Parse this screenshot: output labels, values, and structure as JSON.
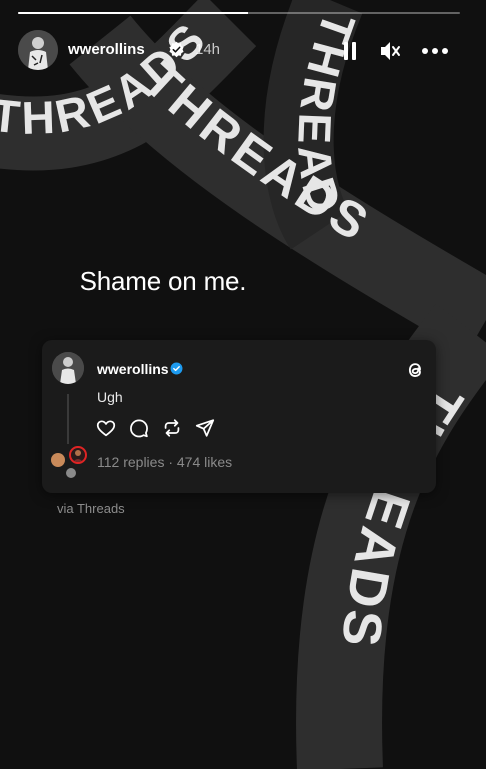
{
  "story": {
    "progress": 0.52,
    "username": "wwerollins",
    "time": "14h",
    "caption": "Shame on me.",
    "via_label": "via Threads",
    "background_ribbon_text": "THREADS",
    "icons": [
      "verified-icon",
      "pause-icon",
      "mute-icon",
      "more-icon"
    ]
  },
  "thread_post": {
    "username": "wwerollins",
    "text": "Ugh",
    "stats": "112 replies · 474 likes",
    "icons": [
      "threads-logo-icon",
      "heart-icon",
      "comment-icon",
      "repost-icon",
      "share-icon"
    ]
  },
  "colors": {
    "background": "#101010",
    "ribbon": "#2e2e2e",
    "ribbon_text": "#e6e6e6",
    "card": "#1b1b1b",
    "verified_blue": "#1d9bf0",
    "reply_avatar_ring": "#e02424"
  }
}
